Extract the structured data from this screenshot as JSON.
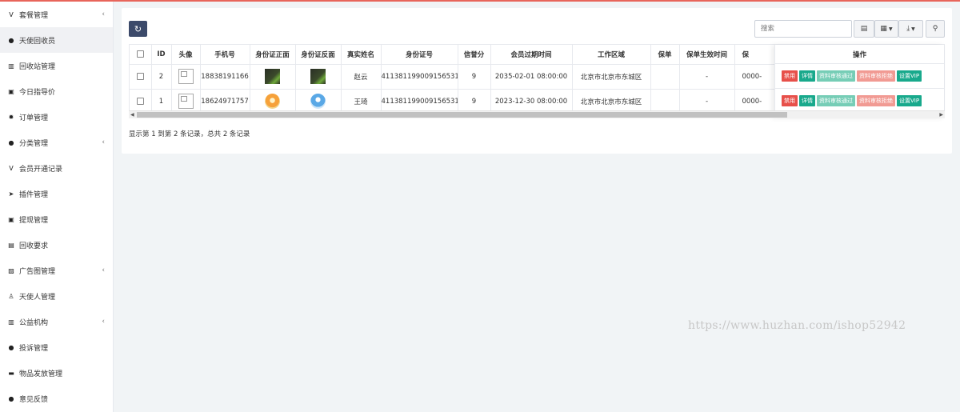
{
  "sidebar": {
    "items": [
      {
        "label": "套餐管理",
        "icon": "vimeo-icon",
        "glyph": "V",
        "has_caret": true,
        "active": false
      },
      {
        "label": "天使回收员",
        "icon": "user-circle-icon",
        "glyph": "●",
        "has_caret": false,
        "active": true
      },
      {
        "label": "回收站管理",
        "icon": "institution-icon",
        "glyph": "▥",
        "has_caret": false,
        "active": false
      },
      {
        "label": "今日指导价",
        "icon": "money-icon",
        "glyph": "▣",
        "has_caret": false,
        "active": false
      },
      {
        "label": "订单管理",
        "icon": "gear-icon",
        "glyph": "✹",
        "has_caret": false,
        "active": false
      },
      {
        "label": "分类管理",
        "icon": "circle-icon",
        "glyph": "●",
        "has_caret": true,
        "active": false
      },
      {
        "label": "会员开通记录",
        "icon": "vimeo-square-icon",
        "glyph": "V",
        "has_caret": false,
        "active": false
      },
      {
        "label": "插件管理",
        "icon": "rocket-icon",
        "glyph": "➤",
        "has_caret": false,
        "active": false
      },
      {
        "label": "提现管理",
        "icon": "money-icon",
        "glyph": "▣",
        "has_caret": false,
        "active": false
      },
      {
        "label": "回收要求",
        "icon": "file-text-icon",
        "glyph": "▤",
        "has_caret": false,
        "active": false
      },
      {
        "label": "广告图管理",
        "icon": "image-icon",
        "glyph": "▨",
        "has_caret": true,
        "active": false
      },
      {
        "label": "天使人管理",
        "icon": "user-icon",
        "glyph": "♙",
        "has_caret": false,
        "active": false
      },
      {
        "label": "公益机构",
        "icon": "institution-icon",
        "glyph": "▥",
        "has_caret": true,
        "active": false
      },
      {
        "label": "投诉管理",
        "icon": "comment-icon",
        "glyph": "●",
        "has_caret": false,
        "active": false
      },
      {
        "label": "物品发放管理",
        "icon": "archive-icon",
        "glyph": "▬",
        "has_caret": false,
        "active": false
      },
      {
        "label": "意见反馈",
        "icon": "comments-icon",
        "glyph": "●",
        "has_caret": false,
        "active": false
      }
    ],
    "caret_glyph": "‹"
  },
  "toolbar": {
    "refresh_icon": "refresh-icon",
    "refresh_glyph": "↻",
    "search_placeholder": "搜索",
    "btn_toggle_glyph": "▤",
    "btn_columns_glyph": "▦",
    "btn_export_glyph": "⤓",
    "btn_search_glyph": "⚲",
    "dropdown_glyph": "▼"
  },
  "table": {
    "headers": [
      "ID",
      "头像",
      "手机号",
      "身份证正面",
      "身份证反面",
      "真实姓名",
      "身份证号",
      "信誉分",
      "会员过期时间",
      "工作区域",
      "保单",
      "保单生效时间",
      "保"
    ],
    "action_header": "操作",
    "rows": [
      {
        "id": "2",
        "phone": "18838191166",
        "id_front": "dark",
        "id_back": "dark",
        "name": "赵云",
        "id_number": "411381199009156531",
        "score": "9",
        "expire": "2035-02-01 08:00:00",
        "area": "北京市北京市东城区",
        "policy": "",
        "policy_time": "-",
        "truncated": "0000-"
      },
      {
        "id": "1",
        "phone": "18624971757",
        "id_front": "avatar-orange",
        "id_back": "avatar-blue",
        "name": "王琦",
        "id_number": "411381199009156531",
        "score": "9",
        "expire": "2023-12-30 08:00:00",
        "area": "北京市北京市东城区",
        "policy": "",
        "policy_time": "-",
        "truncated": "0000-"
      }
    ],
    "actions": [
      {
        "label": "禁用",
        "style": "red"
      },
      {
        "label": "详情",
        "style": "teal"
      },
      {
        "label": "资料审核通过",
        "style": "lteal"
      },
      {
        "label": "资料审核拒绝",
        "style": "pink"
      },
      {
        "label": "设置VIP",
        "style": "teal"
      }
    ]
  },
  "pager": {
    "summary": "显示第 1 到第 2 条记录，总共 2 条记录"
  },
  "watermark": "https://www.huzhan.com/ishop52942",
  "colors": {
    "accent": "#3c4a6a",
    "danger": "#e7504a",
    "success": "#18a98c",
    "topline": "#e8655b"
  }
}
